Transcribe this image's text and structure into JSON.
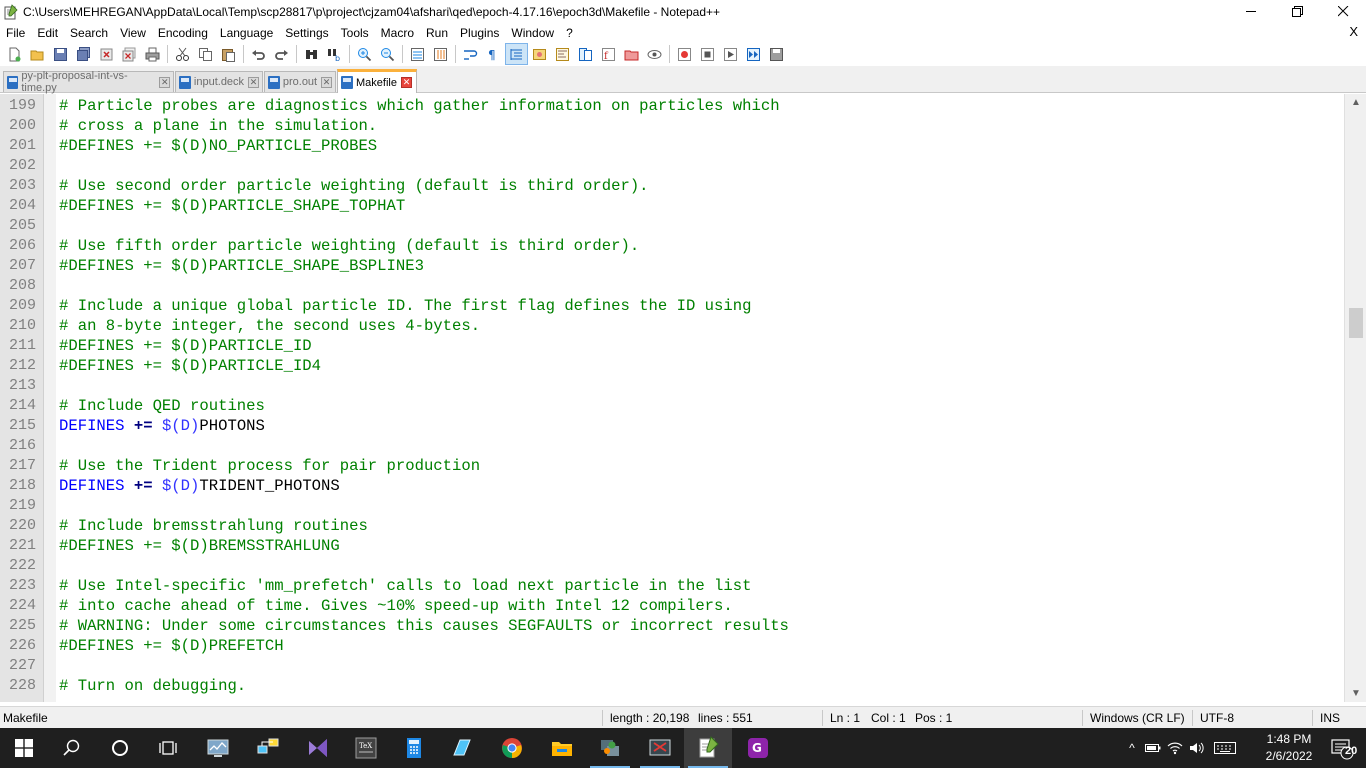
{
  "window": {
    "title": "C:\\Users\\MEHREGAN\\AppData\\Local\\Temp\\scp28817\\p\\project\\cjzam04\\afshari\\qed\\epoch-4.17.16\\epoch3d\\Makefile - Notepad++",
    "minimize": "—",
    "maximize": "❐",
    "close": "✕"
  },
  "menu": {
    "items": [
      "File",
      "Edit",
      "Search",
      "View",
      "Encoding",
      "Language",
      "Settings",
      "Tools",
      "Macro",
      "Run",
      "Plugins",
      "Window",
      "?"
    ],
    "close": "X"
  },
  "tabs": [
    {
      "label": "py-plt-proposal-int-vs-time.py",
      "active": false
    },
    {
      "label": "input.deck",
      "active": false
    },
    {
      "label": "pro.out",
      "active": false
    },
    {
      "label": "Makefile",
      "active": true
    }
  ],
  "tab_close_glyph": "✕",
  "editor": {
    "lines": [
      {
        "n": "199",
        "kind": "comment",
        "text": "# Particle probes are diagnostics which gather information on particles which"
      },
      {
        "n": "200",
        "kind": "comment",
        "text": "# cross a plane in the simulation."
      },
      {
        "n": "201",
        "kind": "comment",
        "text": "#DEFINES += $(D)NO_PARTICLE_PROBES"
      },
      {
        "n": "202",
        "kind": "blank",
        "text": ""
      },
      {
        "n": "203",
        "kind": "comment",
        "text": "# Use second order particle weighting (default is third order)."
      },
      {
        "n": "204",
        "kind": "comment",
        "text": "#DEFINES += $(D)PARTICLE_SHAPE_TOPHAT"
      },
      {
        "n": "205",
        "kind": "blank",
        "text": ""
      },
      {
        "n": "206",
        "kind": "comment",
        "text": "# Use fifth order particle weighting (default is third order)."
      },
      {
        "n": "207",
        "kind": "comment",
        "text": "#DEFINES += $(D)PARTICLE_SHAPE_BSPLINE3"
      },
      {
        "n": "208",
        "kind": "blank",
        "text": ""
      },
      {
        "n": "209",
        "kind": "comment",
        "text": "# Include a unique global particle ID. The first flag defines the ID using"
      },
      {
        "n": "210",
        "kind": "comment",
        "text": "# an 8-byte integer, the second uses 4-bytes."
      },
      {
        "n": "211",
        "kind": "comment",
        "text": "#DEFINES += $(D)PARTICLE_ID"
      },
      {
        "n": "212",
        "kind": "comment",
        "text": "#DEFINES += $(D)PARTICLE_ID4"
      },
      {
        "n": "213",
        "kind": "blank",
        "text": ""
      },
      {
        "n": "214",
        "kind": "comment",
        "text": "# Include QED routines"
      },
      {
        "n": "215",
        "kind": "define",
        "kw": "DEFINES",
        "op": "+=",
        "var": "$(D)",
        "val": "PHOTONS"
      },
      {
        "n": "216",
        "kind": "blank",
        "text": ""
      },
      {
        "n": "217",
        "kind": "comment",
        "text": "# Use the Trident process for pair production"
      },
      {
        "n": "218",
        "kind": "define",
        "kw": "DEFINES",
        "op": "+=",
        "var": "$(D)",
        "val": "TRIDENT_PHOTONS"
      },
      {
        "n": "219",
        "kind": "blank",
        "text": ""
      },
      {
        "n": "220",
        "kind": "comment",
        "text": "# Include bremsstrahlung routines"
      },
      {
        "n": "221",
        "kind": "comment",
        "text": "#DEFINES += $(D)BREMSSTRAHLUNG"
      },
      {
        "n": "222",
        "kind": "blank",
        "text": ""
      },
      {
        "n": "223",
        "kind": "comment",
        "text": "# Use Intel-specific 'mm_prefetch' calls to load next particle in the list"
      },
      {
        "n": "224",
        "kind": "comment",
        "text": "# into cache ahead of time. Gives ~10% speed-up with Intel 12 compilers."
      },
      {
        "n": "225",
        "kind": "comment",
        "text": "# WARNING: Under some circumstances this causes SEGFAULTS or incorrect results"
      },
      {
        "n": "226",
        "kind": "comment",
        "text": "#DEFINES += $(D)PREFETCH"
      },
      {
        "n": "227",
        "kind": "blank",
        "text": ""
      },
      {
        "n": "228",
        "kind": "comment",
        "text": "# Turn on debugging."
      }
    ]
  },
  "scrollbar": {
    "up": "▲",
    "down": "▼",
    "position": 0.36
  },
  "status": {
    "file_type": "Makefile",
    "length": "length : 20,198",
    "lines": "lines : 551",
    "ln": "Ln : 1",
    "col": "Col : 1",
    "pos": "Pos : 1",
    "eol": "Windows (CR LF)",
    "encoding": "UTF-8",
    "mode": "INS"
  },
  "taskbar": {
    "time": "1:48 PM",
    "date": "2/6/2022",
    "notification_count": "20",
    "tray_chevron": "^"
  },
  "colors": {
    "comment": "#008000",
    "keyword": "#0000ff",
    "active_tab_accent": "#fbb13c",
    "taskbar": "#1f1f1f"
  }
}
